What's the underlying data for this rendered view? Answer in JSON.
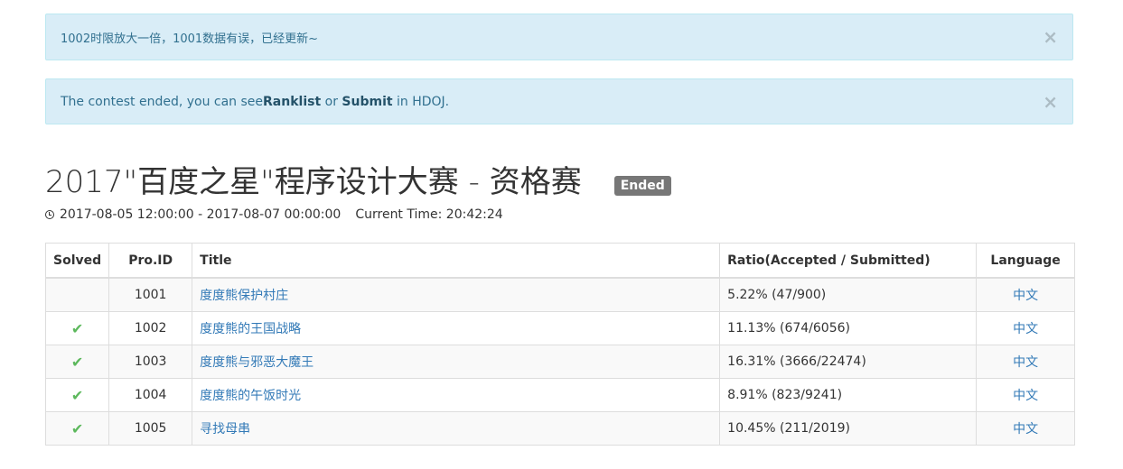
{
  "alerts": [
    {
      "text": "1002时限放大一倍，1001数据有误，已经更新~",
      "close": "×"
    },
    {
      "prefix": "The contest ended, you can see ",
      "ranklist": "Ranklist",
      "or": " or ",
      "submit": "Submit",
      "suffix": " in HDOJ.",
      "close": "×"
    }
  ],
  "contest": {
    "title": "2017\"百度之星\"程序设计大赛 - 资格赛",
    "status": "Ended",
    "time_range": "2017-08-05 12:00:00 - 2017-08-07 00:00:00",
    "current_time": "Current Time: 20:42:24"
  },
  "table": {
    "headers": [
      "Solved",
      "Pro.ID",
      "Title",
      "Ratio(Accepted / Submitted)",
      "Language"
    ],
    "rows": [
      {
        "solved": "",
        "id": "1001",
        "title": "度度熊保护村庄",
        "ratio": "5.22% (47/900)",
        "language": "中文"
      },
      {
        "solved": "✔",
        "id": "1002",
        "title": "度度熊的王国战略",
        "ratio": "11.13% (674/6056)",
        "language": "中文"
      },
      {
        "solved": "✔",
        "id": "1003",
        "title": "度度熊与邪恶大魔王",
        "ratio": "16.31% (3666/22474)",
        "language": "中文"
      },
      {
        "solved": "✔",
        "id": "1004",
        "title": "度度熊的午饭时光",
        "ratio": "8.91% (823/9241)",
        "language": "中文"
      },
      {
        "solved": "✔",
        "id": "1005",
        "title": "寻找母串",
        "ratio": "10.45% (211/2019)",
        "language": "中文"
      }
    ]
  },
  "colors": {
    "alert_bg": "#d9edf7",
    "alert_text": "#31708f",
    "link": "#337ab7",
    "check": "#5cb85c",
    "badge": "#777777"
  }
}
